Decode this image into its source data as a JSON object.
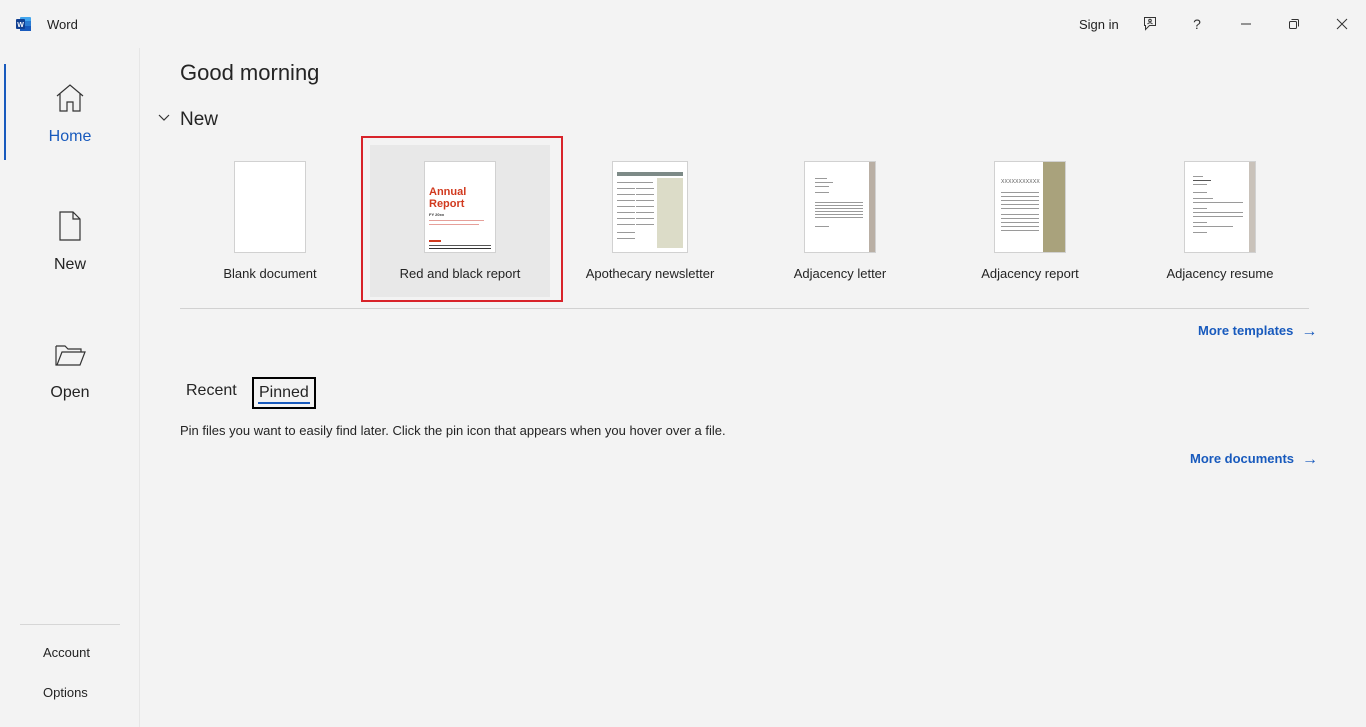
{
  "titlebar": {
    "app_name": "Word",
    "sign_in": "Sign in"
  },
  "sidebar": {
    "items": [
      {
        "label": "Home",
        "icon": "home-icon"
      },
      {
        "label": "New",
        "icon": "new-document-icon"
      },
      {
        "label": "Open",
        "icon": "folder-open-icon"
      }
    ],
    "bottom": [
      {
        "label": "Account"
      },
      {
        "label": "Options"
      }
    ]
  },
  "main": {
    "greeting": "Good morning",
    "new_section_title": "New",
    "templates": [
      {
        "label": "Blank document"
      },
      {
        "label": "Red and black report",
        "thumb_title": "Annual Report",
        "thumb_sub": "FY 20xx"
      },
      {
        "label": "Apothecary newsletter"
      },
      {
        "label": "Adjacency letter"
      },
      {
        "label": "Adjacency report",
        "thumb_title": "XXXXXXXXXXX"
      },
      {
        "label": "Adjacency resume"
      }
    ],
    "more_templates": "More templates",
    "tabs": [
      {
        "label": "Recent"
      },
      {
        "label": "Pinned"
      }
    ],
    "pinned_hint": "Pin files you want to easily find later. Click the pin icon that appears when you hover over a file.",
    "more_documents": "More documents"
  },
  "colors": {
    "accent": "#185abd",
    "selection": "#d8232a",
    "report_red": "#d13a1f"
  }
}
